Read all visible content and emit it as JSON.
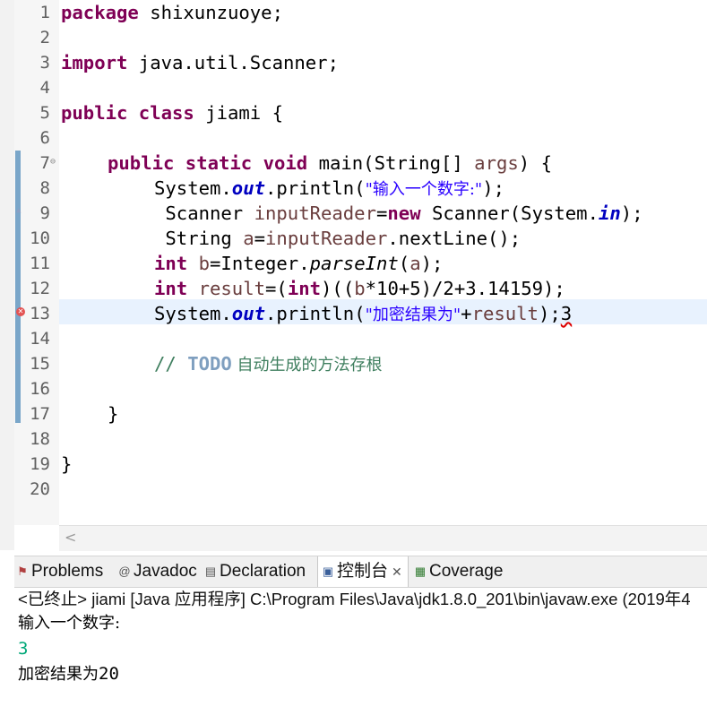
{
  "editor": {
    "line_numbers": [
      "1",
      "2",
      "3",
      "4",
      "5",
      "6",
      "7",
      "8",
      "9",
      "10",
      "11",
      "12",
      "13",
      "14",
      "15",
      "16",
      "17",
      "18",
      "19",
      "20"
    ],
    "lines": {
      "l1": {
        "kw": "package",
        "rest": " shixunzuoye;"
      },
      "l3": {
        "kw": "import",
        "rest": " java.util.Scanner;"
      },
      "l5": {
        "kw": "public class",
        "rest": " jiami {"
      },
      "l7": {
        "kw": "public static void",
        "rest": " main(String[] ",
        "args": "args",
        "tail": ") {"
      },
      "l8": {
        "pre": "System.",
        "field": "out",
        "mid": ".println(",
        "str": "\"输入一个数字:\"",
        "tail": ");"
      },
      "l9": {
        "pre": " Scanner ",
        "var": "inputReader",
        "eq": "=",
        "kw": "new",
        "mid": " Scanner(System.",
        "field": "in",
        "tail": ");"
      },
      "l10": {
        "pre": " String ",
        "var": "a",
        "eq": "=",
        "var2": "inputReader",
        "tail": ".nextLine();"
      },
      "l11": {
        "kw": "int",
        "sp": " ",
        "var": "b",
        "mid": "=Integer.",
        "meth": "parseInt",
        "open": "(",
        "var2": "a",
        "tail": ");"
      },
      "l12": {
        "kw": "int",
        "sp": " ",
        "var": "result",
        "mid": "=(",
        "kw2": "int",
        "mid2": ")((",
        "var2": "b",
        "tail": "*10+5)/2+3.14159);"
      },
      "l13": {
        "pre": "System.",
        "field": "out",
        "mid": ".println(",
        "str": "\"加密结果为\"",
        "plus": "+",
        "var": "result",
        "semi": ");",
        "err": "3"
      },
      "l15": {
        "cmt": "// ",
        "todo": "TODO",
        "cn": " 自动生成的方法存根"
      },
      "l17": {
        "text": "}"
      },
      "l19": {
        "text": "}"
      }
    }
  },
  "tabs": {
    "problems": "Problems",
    "javadoc": "Javadoc",
    "declaration": "Declaration",
    "console": "控制台",
    "console_close": "✕",
    "coverage": "Coverage"
  },
  "console": {
    "header": "<已终止> jiami [Java 应用程序] C:\\Program Files\\Java\\jdk1.8.0_201\\bin\\javaw.exe  (2019年4",
    "out1": "输入一个数字:",
    "input": "3",
    "out2_label": "加密结果为",
    "out2_value": "20"
  },
  "colors": {
    "keyword": "#7f0055",
    "field": "#0000c0",
    "string": "#2a00ff",
    "comment": "#3f7f5f",
    "input": "#00a878"
  }
}
